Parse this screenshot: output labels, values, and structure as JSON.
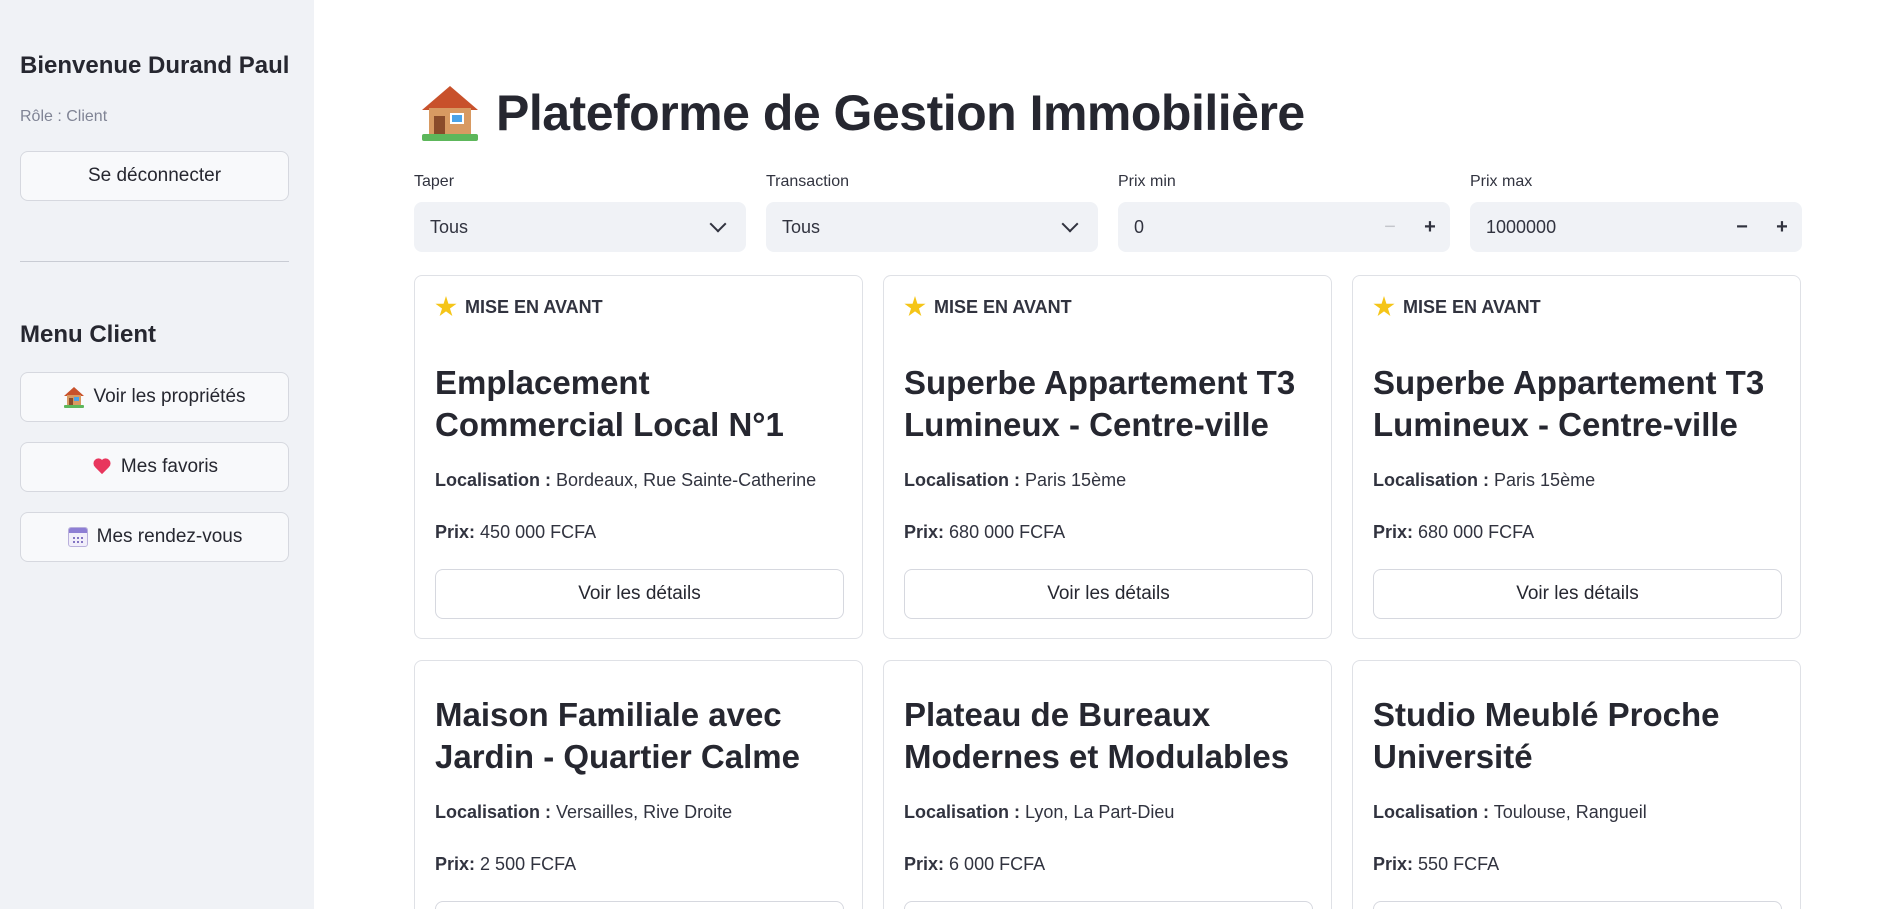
{
  "sidebar": {
    "welcome": "Bienvenue Durand Paul",
    "role": "Rôle : Client",
    "logout_label": "Se déconnecter",
    "menu_title": "Menu Client",
    "items": [
      {
        "label": "Voir les propriétés",
        "icon": "house-icon"
      },
      {
        "label": "Mes favoris",
        "icon": "heart-icon"
      },
      {
        "label": "Mes rendez-vous",
        "icon": "calendar-icon"
      }
    ]
  },
  "main": {
    "title": "Plateforme de Gestion Immobilière",
    "filters": {
      "type": {
        "label": "Taper",
        "value": "Tous"
      },
      "transaction": {
        "label": "Transaction",
        "value": "Tous"
      },
      "price_min": {
        "label": "Prix min",
        "value": "0"
      },
      "price_max": {
        "label": "Prix max",
        "value": "1000000"
      }
    },
    "featured_label": "MISE EN AVANT",
    "location_label": "Localisation :",
    "price_label": "Prix:",
    "details_label": "Voir les détails",
    "properties": [
      {
        "title": "Emplacement Commercial Local N°1",
        "location": "Bordeaux, Rue Sainte-Catherine",
        "price": "450 000 FCFA",
        "featured": true
      },
      {
        "title": "Superbe Appartement T3 Lumineux - Centre-ville",
        "location": "Paris 15ème",
        "price": "680 000 FCFA",
        "featured": true
      },
      {
        "title": "Superbe Appartement T3 Lumineux - Centre-ville",
        "location": "Paris 15ème",
        "price": "680 000 FCFA",
        "featured": true
      },
      {
        "title": "Maison Familiale avec Jardin - Quartier Calme",
        "location": "Versailles, Rive Droite",
        "price": "2 500 FCFA",
        "featured": false
      },
      {
        "title": "Plateau de Bureaux Modernes et Modulables",
        "location": "Lyon, La Part-Dieu",
        "price": "6 000 FCFA",
        "featured": false
      },
      {
        "title": "Studio Meublé Proche Université",
        "location": "Toulouse, Rangueil",
        "price": "550 FCFA",
        "featured": false
      }
    ]
  },
  "colors": {
    "sidebar_bg": "#f0f2f6",
    "text": "#262730",
    "star": "#f5c518",
    "heart": "#e8365d"
  }
}
